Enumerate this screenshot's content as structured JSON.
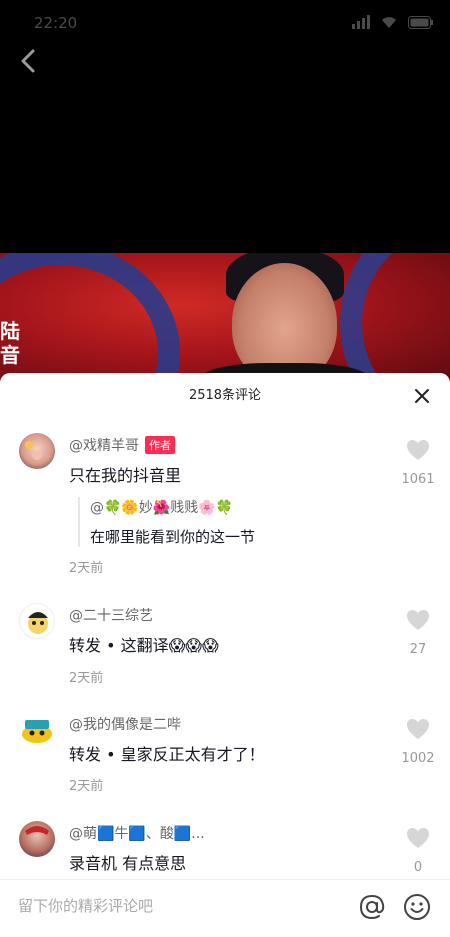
{
  "status_bar": {
    "time": "22:20"
  },
  "video": {
    "caption_chars": "陆\n音"
  },
  "comments_panel": {
    "title": "2518条评论",
    "comments": [
      {
        "author": "@戏精羊哥",
        "author_tag": "作者",
        "text": "只在我的抖音里",
        "time": "2天前",
        "likes": "1061",
        "reply": {
          "author": "@🍀🌼妙🌺贱贱🌸🍀",
          "text": "在哪里能看到你的这一节"
        }
      },
      {
        "author": "@二十三综艺",
        "text": "转发 • 这翻译😱😱😱",
        "time": "2天前",
        "likes": "27"
      },
      {
        "author": "@我的偶像是二哔",
        "text": "转发 • 皇家反正太有才了！",
        "time": "2天前",
        "likes": "1002"
      },
      {
        "author": "@萌🟦牛🟦、酸🟦...",
        "text": "录音机 有点意思",
        "likes": "0"
      }
    ]
  },
  "input": {
    "placeholder": "留下你的精彩评论吧"
  },
  "colors": {
    "author_tag": "#fe2c55",
    "sheet_bg": "#ffffff",
    "video_red": "#c8221f"
  }
}
